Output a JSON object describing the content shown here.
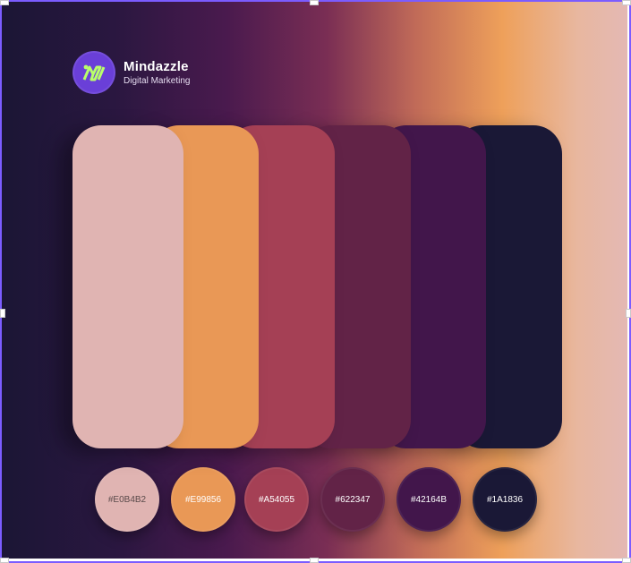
{
  "brand": {
    "name": "Mindazzle",
    "tagline": "Digital Marketing",
    "logo_icon": "mindazzle-logo-icon",
    "logo_color": "#6a3fd8",
    "logo_mark_color": "#b9ff6a"
  },
  "palette": {
    "colors": [
      {
        "hex": "#E0B4B2",
        "label": "#E0B4B2"
      },
      {
        "hex": "#E99856",
        "label": "#E99856"
      },
      {
        "hex": "#A54055",
        "label": "#A54055"
      },
      {
        "hex": "#622347",
        "label": "#622347"
      },
      {
        "hex": "#42164B",
        "label": "#42164B"
      },
      {
        "hex": "#1A1836",
        "label": "#1A1836"
      }
    ]
  },
  "selection_frame_color": "#7b5cff"
}
